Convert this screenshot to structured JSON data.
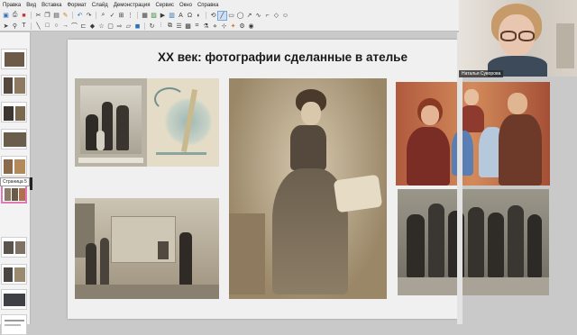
{
  "menu": [
    "Правка",
    "Вид",
    "Вставка",
    "Формат",
    "Слайд",
    "Демонстрация",
    "Сервис",
    "Окно",
    "Справка"
  ],
  "toolbar_row1": [
    "save-icon",
    "print-icon",
    "pdf-icon",
    "cut-icon",
    "copy-icon",
    "paste-icon",
    "clone-format-icon",
    "undo-icon",
    "redo-icon",
    "find-icon",
    "spellcheck-icon",
    "grid-icon",
    "display-grid-icon",
    "table-icon",
    "image-icon",
    "media-icon",
    "chart-icon",
    "textbox-icon",
    "special-char-icon",
    "fontwork-icon",
    "transform-icon",
    "line-icon",
    "rect-icon",
    "ellipse-icon",
    "arrow-icon",
    "curve-icon",
    "connector-icon",
    "shapes-icon",
    "symbol-icon"
  ],
  "toolbar_row2": [
    "select-icon",
    "zoom-icon",
    "text-icon",
    "line-icon",
    "rect-icon",
    "ellipse-icon",
    "arrow-icon",
    "curve-icon",
    "connector-icon",
    "diamond-icon",
    "star-icon",
    "callout-icon",
    "arrows-icon",
    "flowchart-icon",
    "3d-icon",
    "rotate-icon",
    "align-icon",
    "arrange-icon",
    "distribute-icon",
    "shadow-icon",
    "crop-icon",
    "filter-icon",
    "points-icon",
    "glue-icon",
    "toggle-extrusion-icon",
    "interaction-icon",
    "visibility-icon"
  ],
  "slides_panel": {
    "tooltip": "Страница 5",
    "thumbs": [
      1,
      2,
      3,
      4,
      5,
      6,
      7,
      8,
      9,
      10,
      11
    ]
  },
  "slide": {
    "title": "XX век: фотографии сделанные в ателье"
  },
  "video": {
    "participant_name": "Наталья Суворова"
  },
  "colors": {
    "slide_bg": "#f0f0f0",
    "selection": "#e07ab3",
    "toolbar_bg": "#efefef"
  }
}
